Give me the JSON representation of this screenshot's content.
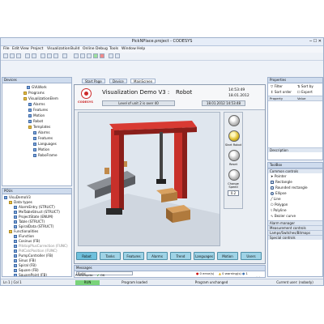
{
  "window": {
    "title": "PickNPlace.project - CODESYS"
  },
  "menu": [
    "File",
    "Edit",
    "View",
    "Project",
    "Visualization",
    "Build",
    "Online",
    "Debug",
    "Tools",
    "Window",
    "Help"
  ],
  "devices": {
    "header": "Devices",
    "items": [
      "GVLWork",
      "Programs",
      "VisualizationElem",
      "Alarms",
      "Features",
      "Motion",
      "Robot",
      "Templates",
      "Alarms",
      "Features",
      "Languages",
      "Motion",
      "RoboFrame"
    ]
  },
  "pous": {
    "header": "POUs",
    "items": [
      "VisuDemoV3",
      "Data types",
      "AlarmEntry (STRUCT)",
      "MeTableStruct (STRUCT)",
      "ProjectState (ENUM)",
      "Table (STRUCT)",
      "SpiralData (STRUCT)",
      "Functionalities",
      "IFunction",
      "Cosinus (FB)",
      "PitstopPlusCorrection (FUNC)",
      "PidCalcPosition (FUNC)",
      "PumpController (FB)",
      "Sinus (FB)",
      "Spiral (FB)",
      "Square (FB)",
      "SquarePoint (FB)"
    ]
  },
  "editor_tabs": [
    "Start Page",
    "Device",
    "MainScreen"
  ],
  "visu": {
    "title": "Visualization Demo V3 :",
    "subtitle": "Robot",
    "logo": "CODESYS",
    "level_text": "Level of unit 2 is over 40",
    "time1": "14:53:49",
    "date1": "18.01.2012",
    "datetime2": "18.01.2012 14:53:48",
    "start_stop": "Start Robot",
    "reset": "Reset",
    "speed_label": "Change Speed",
    "speed_value": "0.2",
    "nav": [
      "Robot",
      "Tanks",
      "Features",
      "Alarms",
      "Trend",
      "Languages",
      "Motion",
      "Users"
    ]
  },
  "properties": {
    "header": "Properties",
    "filter": "Filter",
    "sort_by": "Sort by",
    "sort_order": "Sort order",
    "expert": "Expert",
    "col_property": "Property",
    "col_value": "Value",
    "description": "Description"
  },
  "toolbox": {
    "header": "ToolBox",
    "section1": "Common controls",
    "items": [
      "Pointer",
      "Rectangle",
      "Rounded rectangle",
      "Ellipse",
      "Line",
      "Polygon",
      "Polyline",
      "Bezier curve",
      "Alarm manager",
      "Measurement controls",
      "Lamps/Switches/Bitmaps",
      "Special controls"
    ]
  },
  "messages": {
    "header": "Messages",
    "source": "Build",
    "errors": "0 error(s)",
    "warnings": "0 warning(s)",
    "msgs": "1 message(s)",
    "precompile_label": "Precompile:",
    "precompile_status": "OK"
  },
  "status": {
    "position": "Ln 1 | Col 1",
    "run": "RUN",
    "program_loaded": "Program loaded",
    "program_unchanged": "Program unchanged",
    "current_user": "Current user: (nobody)"
  },
  "colors": {
    "accent": "#9fd3e6",
    "robot_red": "#c8302a",
    "run_green": "#7ad37a"
  }
}
